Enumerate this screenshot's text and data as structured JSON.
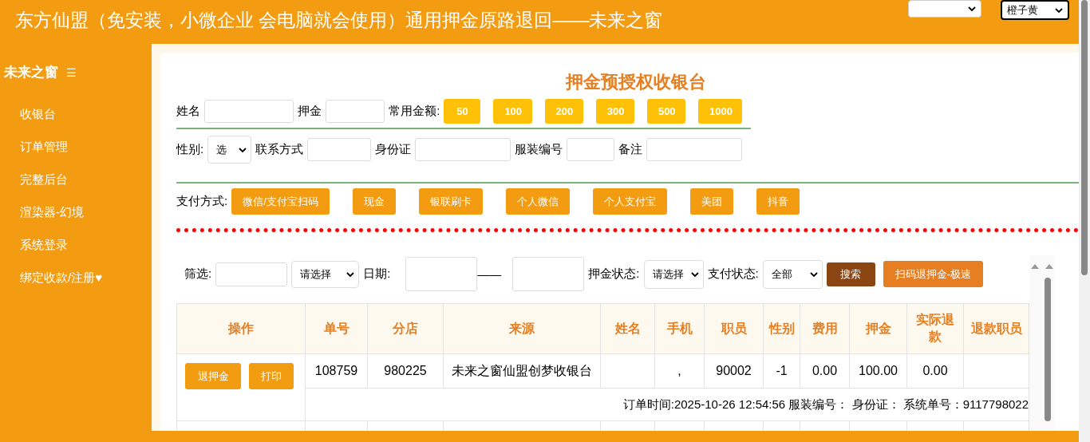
{
  "header": {
    "title": "东方仙盟（免安装，小微企业 会电脑就会使用）通用押金原路退回——未来之窗",
    "theme_select": {
      "value": "橙子黄"
    }
  },
  "sidebar": {
    "brand": "未来之窗",
    "menu_icon": "☰",
    "items": [
      {
        "label": "收银台"
      },
      {
        "label": "订单管理"
      },
      {
        "label": "完整后台"
      },
      {
        "label": "渲染器-幻境"
      },
      {
        "label": "系统登录"
      },
      {
        "label": "绑定收款/注册♥"
      }
    ]
  },
  "form": {
    "title": "押金预授权收银台",
    "row1": [
      {
        "kind": "input",
        "label": "姓名"
      },
      {
        "kind": "input",
        "label": "押金"
      }
    ],
    "amount_label": "常用金额:",
    "amounts": [
      "50",
      "100",
      "200",
      "300",
      "500",
      "1000"
    ],
    "row2": [
      {
        "kind": "select",
        "label": "性别:",
        "value": "选"
      },
      {
        "kind": "input",
        "label": "联系方式"
      },
      {
        "kind": "input",
        "label": "身份证"
      },
      {
        "kind": "input",
        "label": "服装编号"
      },
      {
        "kind": "input",
        "label": "备注"
      }
    ],
    "pay_label": "支付方式:",
    "pay_methods": [
      "微信/支付宝扫码",
      "现金",
      "银联刷卡",
      "个人微信",
      "个人支付宝",
      "美团",
      "抖音"
    ]
  },
  "filter": {
    "label": "筛选:",
    "select": "请选择",
    "date_label": "日期:",
    "date_sep": "——",
    "deposit_status_label": "押金状态:",
    "deposit_status": "请选择",
    "pay_status_label": "支付状态:",
    "pay_status": "全部",
    "search": "搜索",
    "scan_refund": "扫码退押金-极速"
  },
  "table": {
    "columns": [
      "操作",
      "单号",
      "分店",
      "来源",
      "姓名",
      "手机",
      "职员",
      "性别",
      "费用",
      "押金",
      "实际退款",
      "退款职员"
    ],
    "rows": [
      {
        "cells": [
          {
            "buttons": [
              "退押金",
              "打印"
            ]
          },
          "108759",
          "980225",
          "未来之窗仙盟创梦收银台",
          "",
          ",",
          "90002",
          "-1",
          "0.00",
          "100.00",
          "0.00",
          ""
        ],
        "detail": "订单时间:2025-10-26 12:54:56 服装编号：  身份证：  系统单号：9117798022"
      }
    ]
  }
}
